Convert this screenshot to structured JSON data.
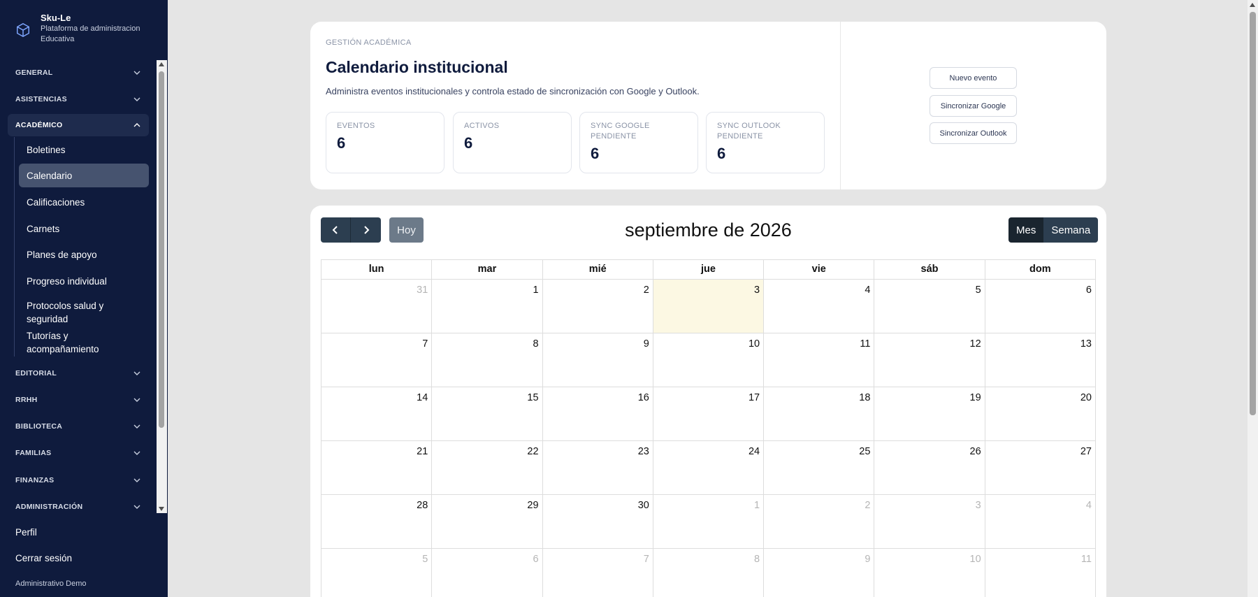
{
  "brand": {
    "name": "Sku-Le",
    "subtitle": "Plataforma de administracion Educativa"
  },
  "sidebar": {
    "groups": [
      {
        "label": "GENERAL"
      },
      {
        "label": "ASISTENCIAS"
      },
      {
        "label": "ACADÉMICO"
      },
      {
        "label": "EDITORIAL"
      },
      {
        "label": "RRHH"
      },
      {
        "label": "BIBLIOTECA"
      },
      {
        "label": "FAMILIAS"
      },
      {
        "label": "FINANZAS"
      },
      {
        "label": "ADMINISTRACIÓN"
      }
    ],
    "academico_items": [
      {
        "label": "Boletines"
      },
      {
        "label": "Calendario"
      },
      {
        "label": "Calificaciones"
      },
      {
        "label": "Carnets"
      },
      {
        "label": "Planes de apoyo"
      },
      {
        "label": "Progreso individual"
      },
      {
        "label": "Protocolos salud y seguridad"
      },
      {
        "label": "Tutorías y acompañamiento"
      }
    ],
    "active_item": "Calendario",
    "footer": {
      "profile": "Perfil",
      "logout": "Cerrar sesión",
      "user": "Administrativo Demo"
    }
  },
  "header": {
    "eyebrow": "GESTIÓN ACADÉMICA",
    "title": "Calendario institucional",
    "description": "Administra eventos institucionales y controla estado de sincronización con Google y Outlook.",
    "stats": [
      {
        "label": "EVENTOS",
        "value": "6"
      },
      {
        "label": "ACTIVOS",
        "value": "6"
      },
      {
        "label": "SYNC GOOGLE PENDIENTE",
        "value": "6"
      },
      {
        "label": "SYNC OUTLOOK PENDIENTE",
        "value": "6"
      }
    ],
    "actions": {
      "new_event": "Nuevo evento",
      "sync_google": "Sincronizar Google",
      "sync_outlook": "Sincronizar Outlook"
    }
  },
  "calendar": {
    "title": "septiembre de 2026",
    "today_label": "Hoy",
    "views": {
      "month": "Mes",
      "week": "Semana"
    },
    "active_view": "Mes",
    "weekdays": [
      "lun",
      "mar",
      "mié",
      "jue",
      "vie",
      "sáb",
      "dom"
    ],
    "weeks": [
      [
        {
          "d": "31",
          "o": true
        },
        {
          "d": "1"
        },
        {
          "d": "2"
        },
        {
          "d": "3",
          "today": true
        },
        {
          "d": "4"
        },
        {
          "d": "5"
        },
        {
          "d": "6"
        }
      ],
      [
        {
          "d": "7"
        },
        {
          "d": "8"
        },
        {
          "d": "9"
        },
        {
          "d": "10"
        },
        {
          "d": "11"
        },
        {
          "d": "12"
        },
        {
          "d": "13"
        }
      ],
      [
        {
          "d": "14"
        },
        {
          "d": "15"
        },
        {
          "d": "16"
        },
        {
          "d": "17"
        },
        {
          "d": "18"
        },
        {
          "d": "19"
        },
        {
          "d": "20"
        }
      ],
      [
        {
          "d": "21"
        },
        {
          "d": "22"
        },
        {
          "d": "23"
        },
        {
          "d": "24"
        },
        {
          "d": "25"
        },
        {
          "d": "26"
        },
        {
          "d": "27"
        }
      ],
      [
        {
          "d": "28"
        },
        {
          "d": "29"
        },
        {
          "d": "30"
        },
        {
          "d": "1",
          "o": true
        },
        {
          "d": "2",
          "o": true
        },
        {
          "d": "3",
          "o": true
        },
        {
          "d": "4",
          "o": true
        }
      ],
      [
        {
          "d": "5",
          "o": true
        },
        {
          "d": "6",
          "o": true
        },
        {
          "d": "7",
          "o": true
        },
        {
          "d": "8",
          "o": true
        },
        {
          "d": "9",
          "o": true
        },
        {
          "d": "10",
          "o": true
        },
        {
          "d": "11",
          "o": true
        }
      ]
    ]
  },
  "colors": {
    "sidebar_bg": "#0f1b3d",
    "today_highlight": "#fcf8e3",
    "toolbar_button": "#2c3e50"
  }
}
